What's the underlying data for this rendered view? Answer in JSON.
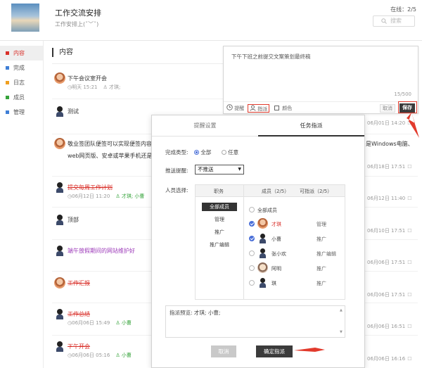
{
  "header": {
    "title": "工作交流安排",
    "subtitle": "工作安排上(ˇ﹀ˇ)",
    "online": "在线：2/5",
    "search_placeholder": "搜索"
  },
  "sidebar": {
    "items": [
      {
        "label": "内容",
        "color": "#d9302a",
        "active": true
      },
      {
        "label": "完成",
        "color": "#3f7fd6"
      },
      {
        "label": "日志",
        "color": "#f0a020"
      },
      {
        "label": "成员",
        "color": "#36a33b"
      },
      {
        "label": "管理",
        "color": "#3f7fd6"
      }
    ]
  },
  "content": {
    "heading": "内容"
  },
  "feed": [
    {
      "text": "下午会议室开会",
      "meta_time": "明天 15:21",
      "meta_assignee": "才琪;",
      "date": "",
      "style": "normal",
      "avatar": "boy"
    },
    {
      "text": "测试",
      "meta_time": "",
      "meta_assignee": "",
      "date": "06月01日 14:20",
      "style": "normal",
      "avatar": "girl"
    },
    {
      "text": "敬业签团队便签可以实现便签内容共",
      "text2": "web网页版、安卓或苹果手机还是iPa",
      "text_right": "是Windows电脑、",
      "meta_time": "",
      "meta_assignee": "",
      "date": "06月18日 17:51",
      "style": "normal",
      "avatar": "boy"
    },
    {
      "text": "提交每周工作计划",
      "meta_time": "06月12日 11:20",
      "meta_assignee": "才琪; 小曹",
      "date": "06月12日 11:40",
      "style": "strike",
      "avatar": "girl"
    },
    {
      "text": "顶部",
      "meta_time": "",
      "meta_assignee": "",
      "date": "06月10日 17:51",
      "style": "normal",
      "avatar": "girl"
    },
    {
      "text": "端午放假期间的网站维护好",
      "meta_time": "",
      "meta_assignee": "",
      "date": "06月06日 17:51",
      "style": "purple",
      "avatar": "girl"
    },
    {
      "text": "工作汇报",
      "meta_time": "",
      "meta_assignee": "",
      "date": "06月06日 17:51",
      "style": "strike",
      "avatar": "boy"
    },
    {
      "text": "工作总结",
      "meta_time": "06月06日 15:49",
      "meta_assignee": "小曹",
      "date": "06月06日 16:51",
      "style": "strike",
      "avatar": "girl"
    },
    {
      "text": "下午开会",
      "meta_time": "06月06日 05:16",
      "meta_assignee": "小曹",
      "date": "06月06日 16:16",
      "style": "strike",
      "avatar": "girl"
    }
  ],
  "editor": {
    "text": "下午下班之前提交文案策划最终稿",
    "count": "15/500",
    "tool_remind": "提醒",
    "tool_assign": "指派",
    "tool_color": "颜色",
    "cancel": "取消",
    "save": "保存"
  },
  "modal": {
    "tab_remind": "提醒设置",
    "tab_assign": "任务指派",
    "complete_type_label": "完成类型:",
    "complete_all": "全部",
    "complete_any": "任意",
    "push_label": "推送提醒:",
    "push_value": "不推送",
    "people_label": "人员选择:",
    "col_role": "职务",
    "col_members": "成员（2/5）",
    "col_assignable": "可指派（2/5）",
    "roles": [
      "全部成员",
      "管理",
      "推广",
      "推广编辑"
    ],
    "select_all": "全部成员",
    "members": [
      {
        "name": "才琪",
        "role": "管理",
        "checked": true,
        "avatar": "boy",
        "highlight": true
      },
      {
        "name": "小曹",
        "role": "推广",
        "checked": true,
        "avatar": "girl"
      },
      {
        "name": "张小欢",
        "role": "推广编辑",
        "checked": false,
        "avatar": "girl"
      },
      {
        "name": "阿明",
        "role": "推广",
        "checked": false,
        "avatar": "k"
      },
      {
        "name": "琪",
        "role": "推广",
        "checked": false,
        "avatar": "girl"
      }
    ],
    "preview_label": "指派预览:",
    "preview_value": "才琪; 小曹;",
    "cancel": "取消",
    "confirm": "确定指派"
  },
  "colors": {
    "accent": "#d9302a",
    "dark_button": "#3b3b3b",
    "arrow": "#e23a2c",
    "check": "#4a6fd8"
  }
}
